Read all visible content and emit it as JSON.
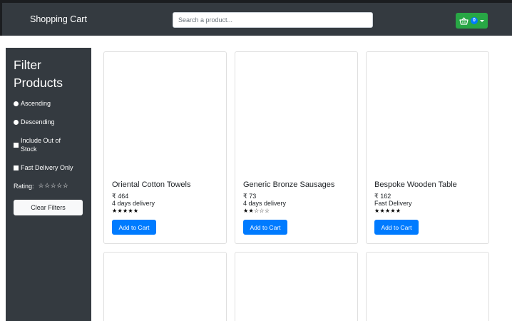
{
  "navbar": {
    "brand": "Shopping Cart",
    "search_placeholder": "Search a product...",
    "cart_count": "0",
    "cart_color": "#28a745"
  },
  "sidebar": {
    "title_line1": "Filter",
    "title_line2": "Products",
    "sort_ascending": "Ascending",
    "sort_descending": "Descending",
    "include_out_of_stock_line1": "Include Out of",
    "include_out_of_stock_line2": "Stock",
    "fast_delivery_only": "Fast Delivery Only",
    "rating_label": "Rating:",
    "rating_stars": "☆☆☆☆☆",
    "clear_filters": "Clear Filters"
  },
  "products": [
    {
      "name": "Oriental Cotton Towels",
      "price": "₹ 464",
      "delivery": "4 days delivery",
      "rating_stars": "★★★★★",
      "rating": 5,
      "button": "Add to Cart"
    },
    {
      "name": "Generic Bronze Sausages",
      "price": "₹ 73",
      "delivery": "4 days delivery",
      "rating_stars": "★★☆☆☆",
      "rating": 2,
      "button": "Add to Cart"
    },
    {
      "name": "Bespoke Wooden Table",
      "price": "₹ 162",
      "delivery": "Fast Delivery",
      "rating_stars": "★★★★★",
      "rating": 5,
      "button": "Add to Cart"
    }
  ],
  "colors": {
    "navbar_bg": "#343a40",
    "primary": "#007bff"
  }
}
